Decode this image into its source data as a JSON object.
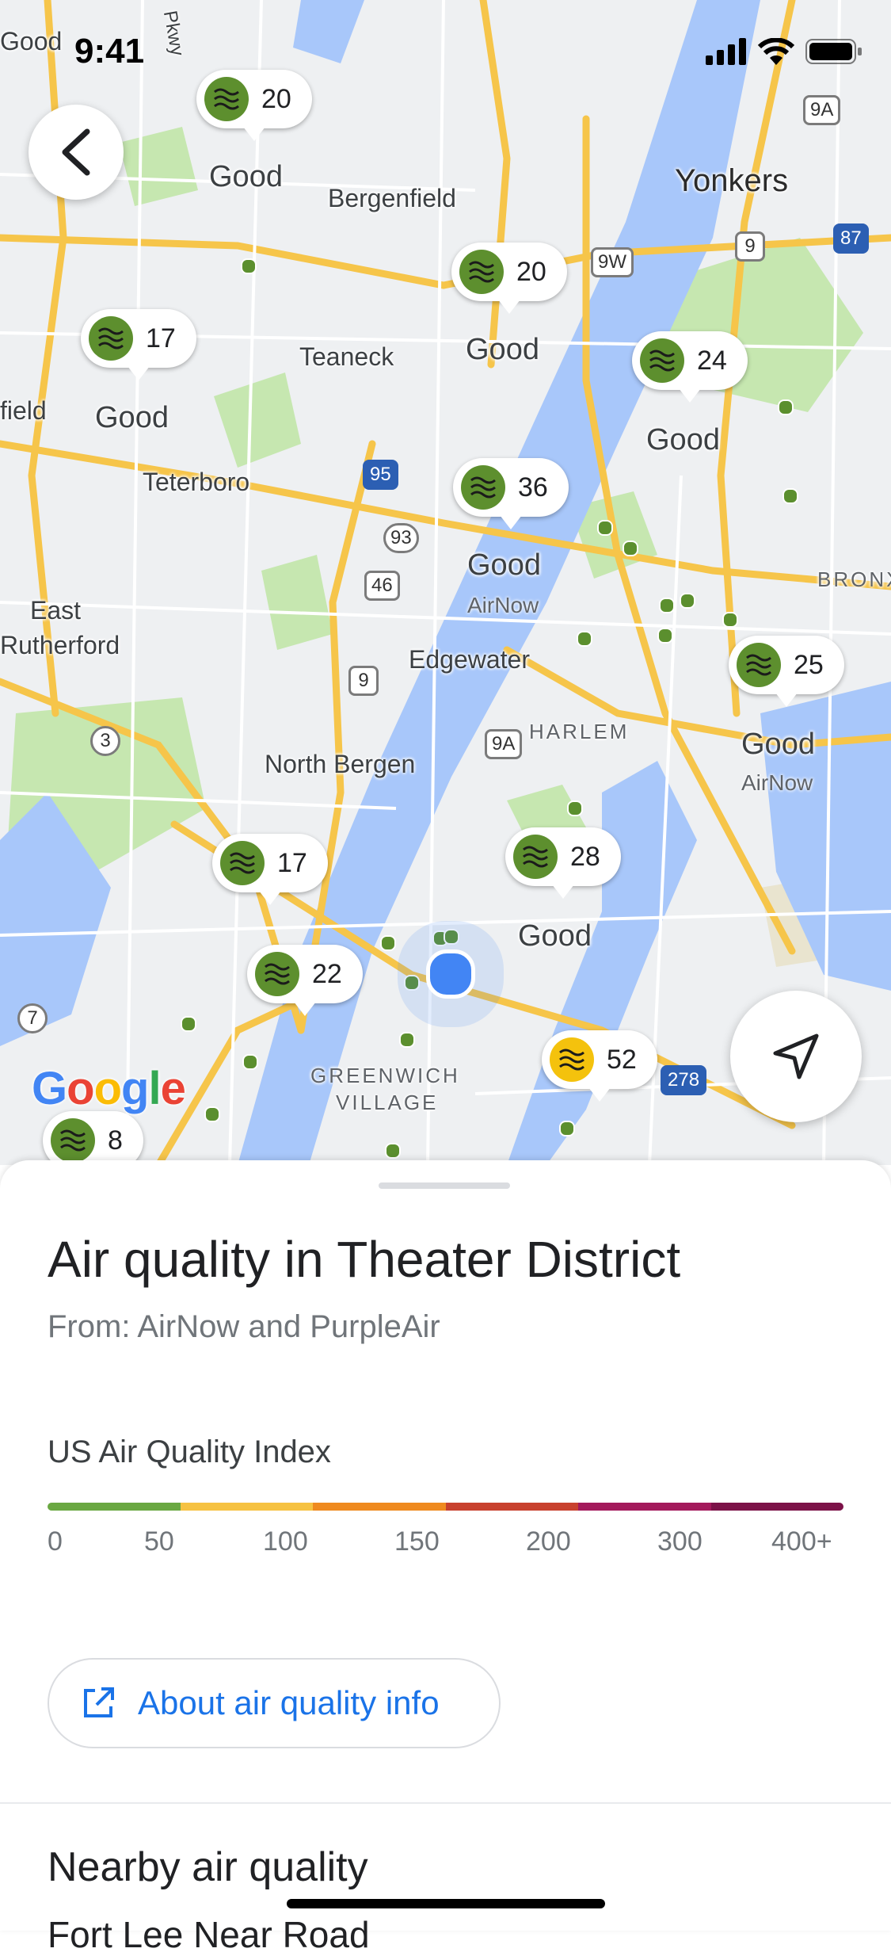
{
  "status_bar": {
    "time": "9:41"
  },
  "map": {
    "labels": {
      "bergenfield": "Bergenfield",
      "yonkers": "Yonkers",
      "teaneck": "Teaneck",
      "teterboro": "Teterboro",
      "east": "East",
      "rutherford": "Rutherford",
      "edgewater": "Edgewater",
      "harlem": "HARLEM",
      "north_bergen": "North Bergen",
      "bronx": "BRONX",
      "greenwich1": "GREENWICH",
      "greenwich2": "VILLAGE",
      "field": "field",
      "good_top": "Good",
      "parkway": "Pkwy"
    },
    "air_markers": [
      {
        "value": "20",
        "status": "Good",
        "source": ""
      },
      {
        "value": "20",
        "status": "Good",
        "source": ""
      },
      {
        "value": "17",
        "status": "Good",
        "source": ""
      },
      {
        "value": "24",
        "status": "Good",
        "source": ""
      },
      {
        "value": "36",
        "status": "Good",
        "source": "AirNow"
      },
      {
        "value": "25",
        "status": "Good",
        "source": "AirNow"
      },
      {
        "value": "17",
        "status": "",
        "source": ""
      },
      {
        "value": "28",
        "status": "Good",
        "source": ""
      },
      {
        "value": "22",
        "status": "",
        "source": ""
      },
      {
        "value": "52",
        "status": "",
        "source": ""
      },
      {
        "value": "8",
        "status": "",
        "source": ""
      }
    ],
    "shields": [
      "9A",
      "9",
      "9W",
      "87",
      "95",
      "93",
      "46",
      "9",
      "9A",
      "3",
      "7",
      "278"
    ],
    "google_logo": "Google",
    "colors": {
      "good": "#5d8f2e",
      "moderate": "#f4c20d",
      "water": "#a8c7fa",
      "park": "#c6e7b0",
      "highway": "#f6c54a"
    }
  },
  "sheet": {
    "title": "Air quality in Theater District",
    "subtitle": "From: AirNow and PurpleAir",
    "index_title": "US Air Quality Index",
    "scale_ticks": [
      "0",
      "50",
      "100",
      "150",
      "200",
      "300",
      "400+"
    ],
    "scale_colors": [
      "#6aa842",
      "#f6c242",
      "#ef8a1f",
      "#c8412e",
      "#a3195b",
      "#7c1248"
    ],
    "about_button": "About air quality info",
    "nearby_title": "Nearby air quality",
    "next_item": "Fort Lee Near Road"
  }
}
